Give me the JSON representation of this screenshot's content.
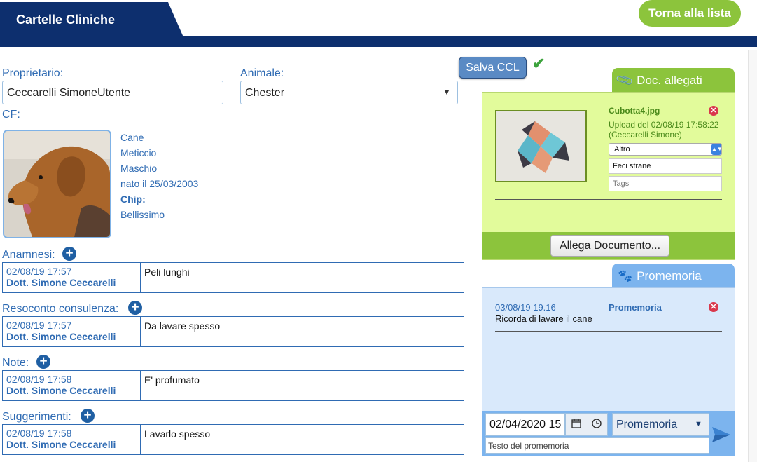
{
  "header": {
    "title": "Cartelle Cliniche",
    "back_button": "Torna alla lista"
  },
  "form": {
    "owner_label": "Proprietario:",
    "owner_value": "Ceccarelli SimoneUtente",
    "animal_label": "Animale:",
    "animal_value": "Chester",
    "cf_label": "CF:"
  },
  "pet": {
    "species": "Cane",
    "breed": "Meticcio",
    "sex": "Maschio",
    "birth": "nato il 25/03/2003",
    "chip_label": "Chip:",
    "notes": "Bellissimo"
  },
  "sections": [
    {
      "label": "Anamnesi:",
      "date": "02/08/19 17:57",
      "author": "Dott. Simone Ceccarelli",
      "text": "Peli lunghi"
    },
    {
      "label": "Resoconto consulenza:",
      "date": "02/08/19 17:57",
      "author": "Dott. Simone Ceccarelli",
      "text": "Da lavare spesso"
    },
    {
      "label": "Note:",
      "date": "02/08/19 17:58",
      "author": "Dott. Simone Ceccarelli",
      "text": "E' profumato"
    },
    {
      "label": "Suggerimenti:",
      "date": "02/08/19 17:58",
      "author": "Dott. Simone Ceccarelli",
      "text": "Lavarlo spesso"
    }
  ],
  "save_button": "Salva CCL",
  "documents": {
    "tab_label": "Doc. allegati",
    "file_name": "Cubotta4.jpg",
    "upload_info": "Upload del 02/08/19 17:58:22 (Ceccarelli Simone)",
    "type_value": "Altro",
    "description": "Feci strane",
    "tags_placeholder": "Tags",
    "attach_button": "Allega Documento..."
  },
  "reminders": {
    "tab_label": "Promemoria",
    "item_date": "03/08/19 19.16",
    "item_type": "Promemoria",
    "item_text": "Ricorda di lavare il cane",
    "date_input": "02/04/2020 15",
    "type_select": "Promemoria",
    "note_placeholder": "Testo del promemoria"
  },
  "colors": {
    "navy": "#0d2f6e",
    "green": "#8cc43c",
    "blue_text": "#2f6bb3",
    "light_blue": "#7cb4ee"
  }
}
